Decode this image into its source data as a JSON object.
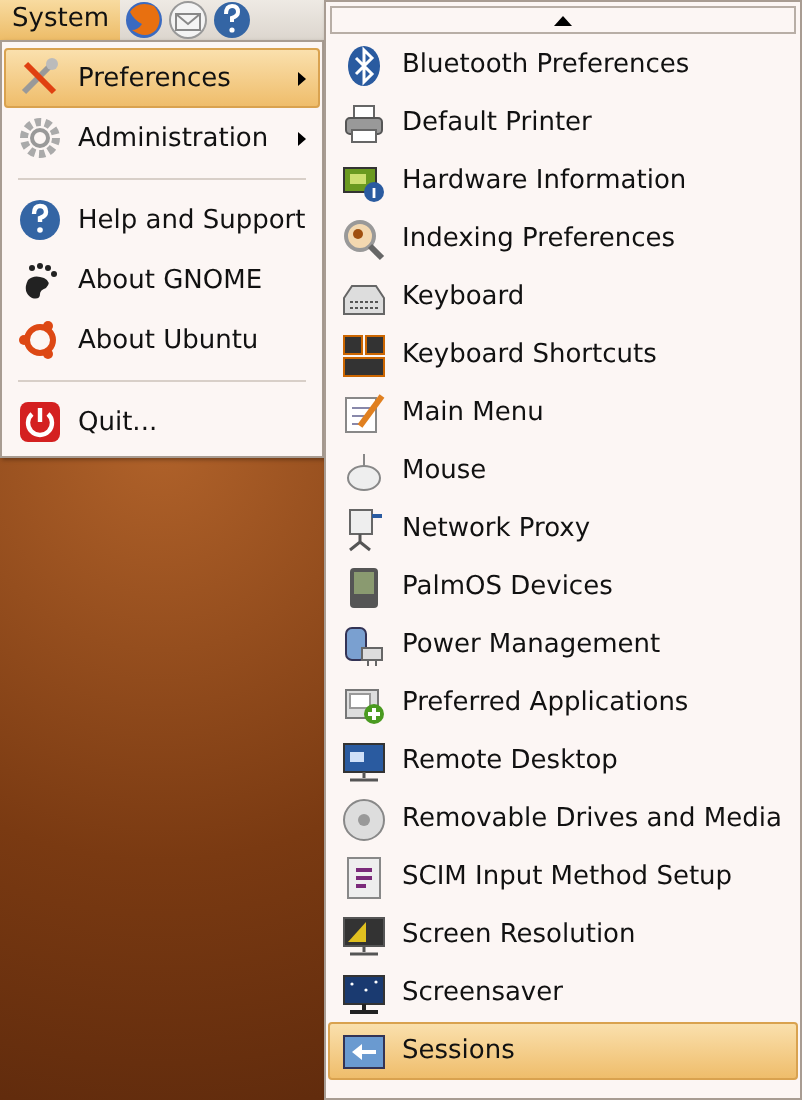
{
  "panel": {
    "menu": {
      "label": "System",
      "selected": true
    }
  },
  "system_menu": {
    "items": [
      {
        "kind": "item",
        "label": "Preferences",
        "selected": true,
        "submenu": true
      },
      {
        "kind": "item",
        "label": "Administration",
        "selected": false,
        "submenu": true
      },
      {
        "kind": "separator"
      },
      {
        "kind": "item",
        "label": "Help and Support",
        "selected": false,
        "submenu": false
      },
      {
        "kind": "item",
        "label": "About GNOME",
        "selected": false,
        "submenu": false
      },
      {
        "kind": "item",
        "label": "About Ubuntu",
        "selected": false,
        "submenu": false
      },
      {
        "kind": "separator"
      },
      {
        "kind": "item",
        "label": "Quit...",
        "selected": false,
        "submenu": false
      }
    ]
  },
  "preferences_menu": {
    "items": [
      {
        "label": "Bluetooth Preferences",
        "selected": false
      },
      {
        "label": "Default Printer",
        "selected": false
      },
      {
        "label": "Hardware Information",
        "selected": false
      },
      {
        "label": "Indexing Preferences",
        "selected": false
      },
      {
        "label": "Keyboard",
        "selected": false
      },
      {
        "label": "Keyboard Shortcuts",
        "selected": false
      },
      {
        "label": "Main Menu",
        "selected": false
      },
      {
        "label": "Mouse",
        "selected": false
      },
      {
        "label": "Network Proxy",
        "selected": false
      },
      {
        "label": "PalmOS Devices",
        "selected": false
      },
      {
        "label": "Power Management",
        "selected": false
      },
      {
        "label": "Preferred Applications",
        "selected": false
      },
      {
        "label": "Remote Desktop",
        "selected": false
      },
      {
        "label": "Removable Drives and Media",
        "selected": false
      },
      {
        "label": "SCIM Input Method Setup",
        "selected": false
      },
      {
        "label": "Screen Resolution",
        "selected": false
      },
      {
        "label": "Screensaver",
        "selected": false
      },
      {
        "label": "Sessions",
        "selected": true
      }
    ]
  }
}
